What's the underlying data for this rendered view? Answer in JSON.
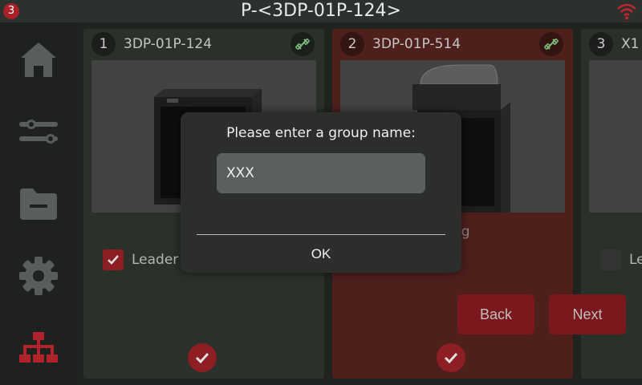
{
  "topbar": {
    "notification_count": "3",
    "title": "P-<3DP-01P-124>",
    "wifi_icon": "wifi-icon",
    "wifi_color": "#c0262d"
  },
  "sidebar": {
    "items": [
      {
        "name": "home",
        "icon": "home-icon"
      },
      {
        "name": "settings-sliders",
        "icon": "sliders-icon"
      },
      {
        "name": "files",
        "icon": "folder-icon"
      },
      {
        "name": "settings",
        "icon": "gear-icon"
      },
      {
        "name": "network",
        "icon": "network-icon",
        "active": true
      }
    ]
  },
  "cards": [
    {
      "number": "1",
      "name": "3DP-01P-124",
      "leader_label": "Leader",
      "leader_checked": true,
      "selected": true
    },
    {
      "number": "2",
      "name": "3DP-01P-514",
      "status_text": "ng",
      "selected": true
    },
    {
      "number": "3",
      "name": "X1",
      "leader_label": "Le",
      "leader_checked": false
    }
  ],
  "buttons": {
    "back": "Back",
    "next": "Next"
  },
  "dialog": {
    "prompt": "Please enter a group name:",
    "input_value": "XXX",
    "ok_label": "OK"
  },
  "colors": {
    "accent": "#a0232a",
    "card_default": "#313731",
    "card_selected": "#5a2420"
  }
}
